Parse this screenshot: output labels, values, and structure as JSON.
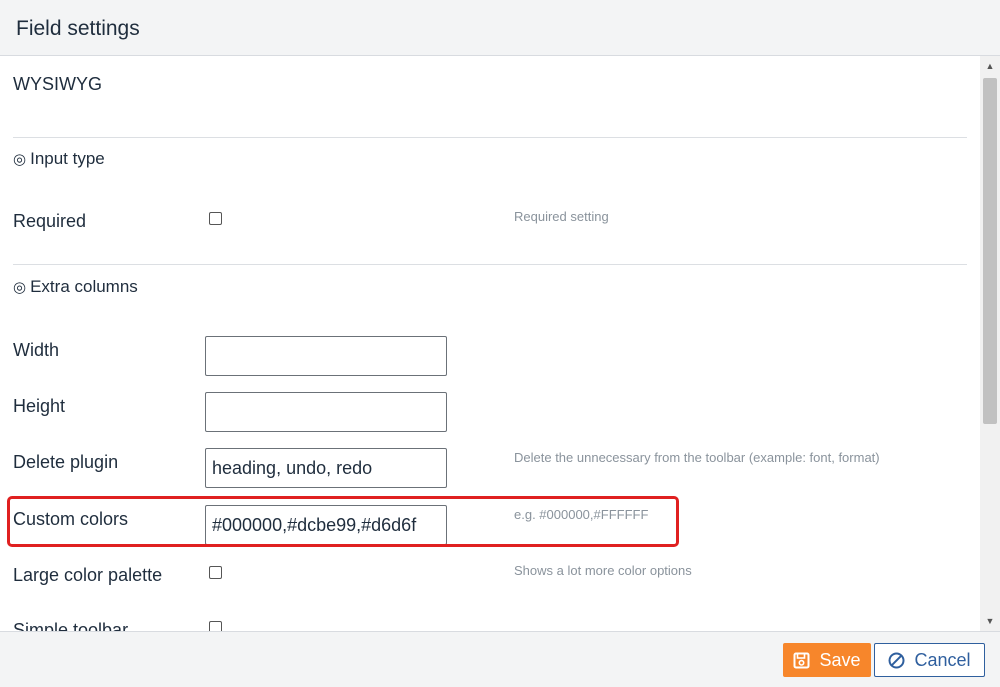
{
  "dialog": {
    "title": "Field settings"
  },
  "field_type": "WYSIWYG",
  "sections": {
    "input_type": {
      "icon": "double-circle-icon",
      "title": "Input type"
    },
    "extra_columns": {
      "icon": "double-circle-icon",
      "title": "Extra columns"
    }
  },
  "fields": {
    "required": {
      "label": "Required",
      "checked": false,
      "hint": "Required setting"
    },
    "width": {
      "label": "Width",
      "value": ""
    },
    "height": {
      "label": "Height",
      "value": ""
    },
    "delete_plugin": {
      "label": "Delete plugin",
      "value": "heading, undo, redo",
      "hint": "Delete the unnecessary from the toolbar (example: font, format)"
    },
    "custom_colors": {
      "label": "Custom colors",
      "value": "#000000,#dcbe99,#d6d6f",
      "hint": "e.g. #000000,#FFFFFF"
    },
    "large_color_palette": {
      "label": "Large color palette",
      "checked": false,
      "hint": "Shows a lot more color options"
    },
    "simple_toolbar": {
      "label": "Simple toolbar",
      "checked": false
    }
  },
  "footer": {
    "save_label": "Save",
    "cancel_label": "Cancel"
  },
  "colors": {
    "accent_save": "#f7862b",
    "accent_cancel": "#2f5f9e",
    "highlight": "#e02020"
  }
}
